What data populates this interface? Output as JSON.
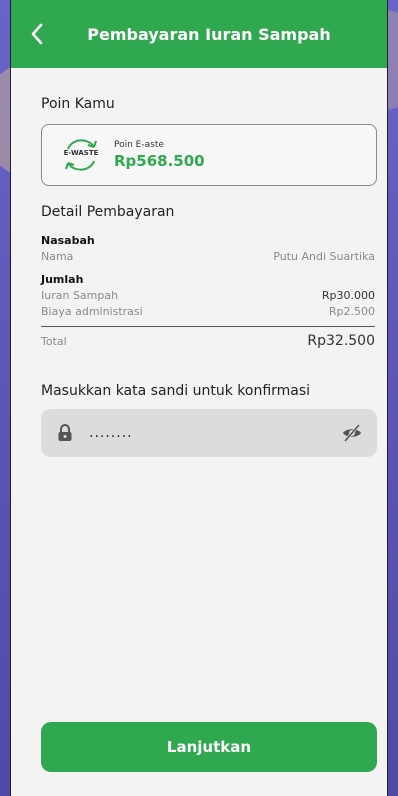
{
  "header": {
    "title": "Pembayaran Iuran Sampah"
  },
  "poin": {
    "section_title": "Poin Kamu",
    "logo_text": "E-WASTE",
    "label": "Poin E-aste",
    "value": "Rp568.500"
  },
  "detail": {
    "section_title": "Detail Pembayaran",
    "nasabah_label": "Nasabah",
    "nama_label": "Nama",
    "nama_value": "Putu Andi Suartika",
    "jumlah_label": "Jumlah",
    "iuran_label": "Iuran Sampah",
    "iuran_value": "Rp30.000",
    "admin_label": "Biaya administrasi",
    "admin_value": "Rp2.500",
    "total_label": "Total",
    "total_value": "Rp32.500"
  },
  "password": {
    "title": "Masukkan kata sandi untuk konfirmasi",
    "value": "........"
  },
  "action": {
    "button_label": "Lanjutkan"
  },
  "colors": {
    "primary": "#2fa84f",
    "background": "#f3f3f3",
    "field": "#dcdcdc"
  }
}
